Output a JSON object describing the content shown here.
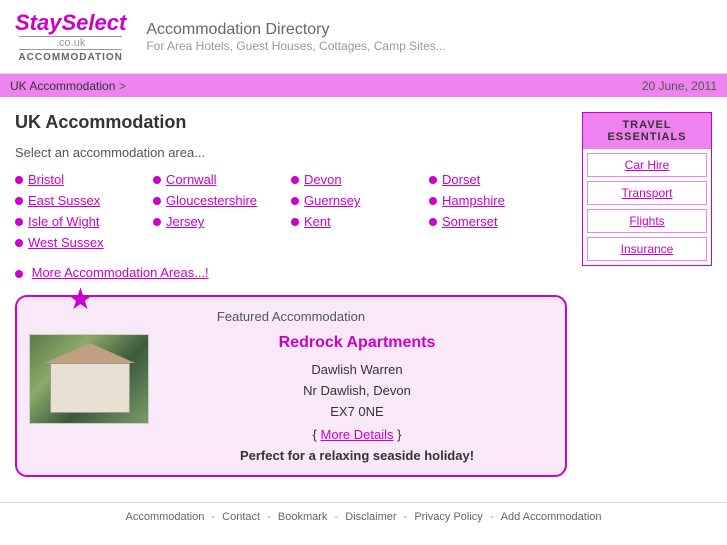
{
  "header": {
    "logo_stay": "Stay",
    "logo_select": "Select",
    "logo_co": ".co.uk",
    "logo_accommodation": "ACCOMMODATION",
    "title": "Accommodation Directory",
    "subtitle": "For Area Hotels, Guest Houses, Cottages, Camp Sites..."
  },
  "breadcrumb": {
    "link": "UK Accommodation",
    "chevron": ">",
    "date": "20 June, 2011"
  },
  "main": {
    "page_title": "UK Accommodation",
    "select_text": "Select an accommodation area...",
    "areas": [
      [
        "Bristol",
        "East Sussex",
        "Isle of Wight",
        "West Sussex"
      ],
      [
        "Cornwall",
        "Gloucestershire",
        "Jersey",
        ""
      ],
      [
        "Devon",
        "Guernsey",
        "Kent",
        ""
      ],
      [
        "Dorset",
        "Hampshire",
        "Somerset",
        ""
      ]
    ],
    "more_areas_text": "More Accommodation Areas...!",
    "featured": {
      "title": "Featured Accommodation",
      "name": "Redrock Apartments",
      "address_line1": "Dawlish Warren",
      "address_line2": "Nr Dawlish, Devon",
      "address_line3": "EX7 0NE",
      "more_details_label": "More Details",
      "tagline": "Perfect for a relaxing seaside holiday!"
    }
  },
  "sidebar": {
    "header": "TRAVEL\nESSENTIALS",
    "items": [
      "Car Hire",
      "Transport",
      "Flights",
      "Insurance"
    ]
  },
  "footer": {
    "links": [
      "Accommodation",
      "Contact",
      "Bookmark",
      "Disclaimer",
      "Privacy Policy",
      "Add Accommodation"
    ],
    "separator": "-"
  }
}
